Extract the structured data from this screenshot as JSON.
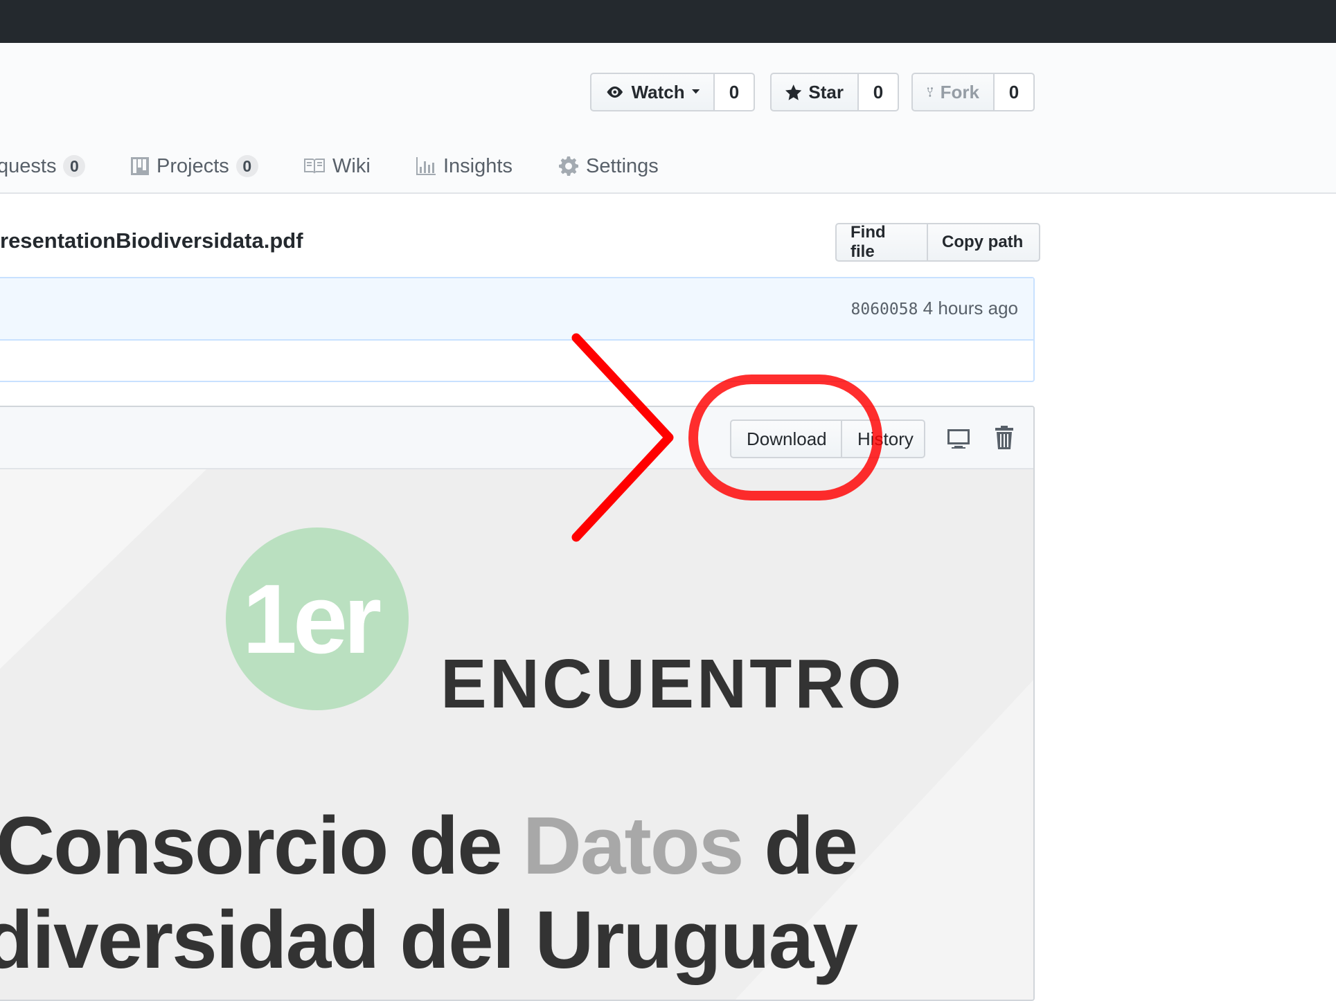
{
  "repo_actions": {
    "watch": {
      "label": "Watch",
      "count": "0"
    },
    "star": {
      "label": "Star",
      "count": "0"
    },
    "fork": {
      "label": "Fork",
      "count": "0"
    }
  },
  "tabs": [
    {
      "label": "quests",
      "count": "0"
    },
    {
      "label": "Projects",
      "count": "0"
    },
    {
      "label": "Wiki"
    },
    {
      "label": "Insights"
    },
    {
      "label": "Settings"
    }
  ],
  "file": {
    "path": "resentationBiodiversidata.pdf",
    "find_file_label": "Find file",
    "copy_path_label": "Copy path"
  },
  "commit": {
    "sha": "8060058",
    "time": "4 hours ago"
  },
  "file_actions": {
    "download_label": "Download",
    "history_label": "History"
  },
  "preview": {
    "logo_text": "1er",
    "heading": "ENCUENTRO",
    "line1_pre": "Consorcio de ",
    "line1_accent": "Datos",
    "line1_post": " de",
    "line2": "diversidad del Uruguay"
  },
  "colors": {
    "topbar": "#24292e",
    "annotation": "#ff0000",
    "logo_green": "#bae0c0",
    "accent_gray": "#a8a8a8"
  }
}
